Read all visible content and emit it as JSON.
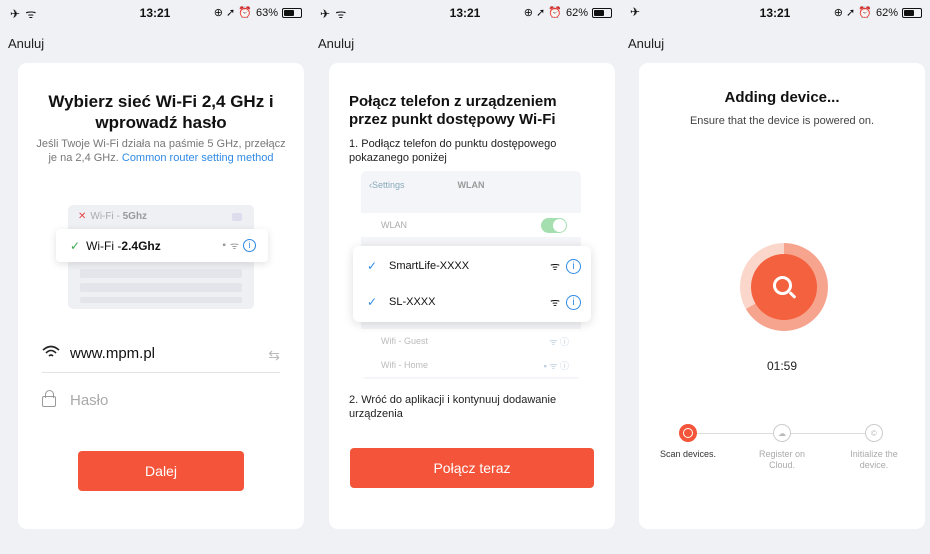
{
  "screens": [
    {
      "status": {
        "left": "✈ ᯤ",
        "time": "13:21",
        "battery": "63%",
        "battery_level": 0.63
      },
      "back_label": "Anuluj",
      "title": "Wybierz sieć Wi-Fi 2,4 GHz i wprowadź hasło",
      "subtitle": "Jeśli Twoje Wi-Fi działa na paśmie 5 GHz, przełącz je na 2,4 GHz.",
      "link_label": "Common router setting method",
      "illustration": {
        "row_5g_prefix": "Wi-Fi - ",
        "row_5g_band": "5Ghz",
        "row_24_prefix": "Wi-Fi - ",
        "row_24_band": "2.4Ghz"
      },
      "ssid_value": "www.mpm.pl",
      "password_placeholder": "Hasło",
      "button_label": "Dalej"
    },
    {
      "status": {
        "left": "✈ ᯤ",
        "time": "13:21",
        "battery": "62%",
        "battery_level": 0.62
      },
      "back_label": "Anuluj",
      "title": "Połącz telefon z urządzeniem przez punkt dostępowy Wi-Fi",
      "step1": "1. Podłącz telefon do punktu dostępowego pokazanego poniżej",
      "ios": {
        "back": "Settings",
        "nav_title": "WLAN",
        "wlan_label": "WLAN",
        "networks": [
          "SmartLife-XXXX",
          "SL-XXXX"
        ],
        "other_networks": [
          "Wifi - Guest",
          "Wifi - Home"
        ]
      },
      "step2": "2. Wróć do aplikacji i kontynuuj dodawanie urządzenia",
      "button_label": "Połącz teraz"
    },
    {
      "status": {
        "left": "✈",
        "time": "13:21",
        "battery": "62%",
        "battery_level": 0.62
      },
      "back_label": "Anuluj",
      "title": "Adding device...",
      "subtitle": "Ensure that the device is powered on.",
      "timer": "01:59",
      "steps": [
        "Scan devices.",
        "Register on Cloud.",
        "Initialize the device."
      ]
    }
  ],
  "colors": {
    "accent": "#f4553a",
    "link": "#2f8ae5",
    "check_green": "#3aa94d"
  },
  "icons": {
    "status_right": "⊕ ➚ ⏰"
  }
}
